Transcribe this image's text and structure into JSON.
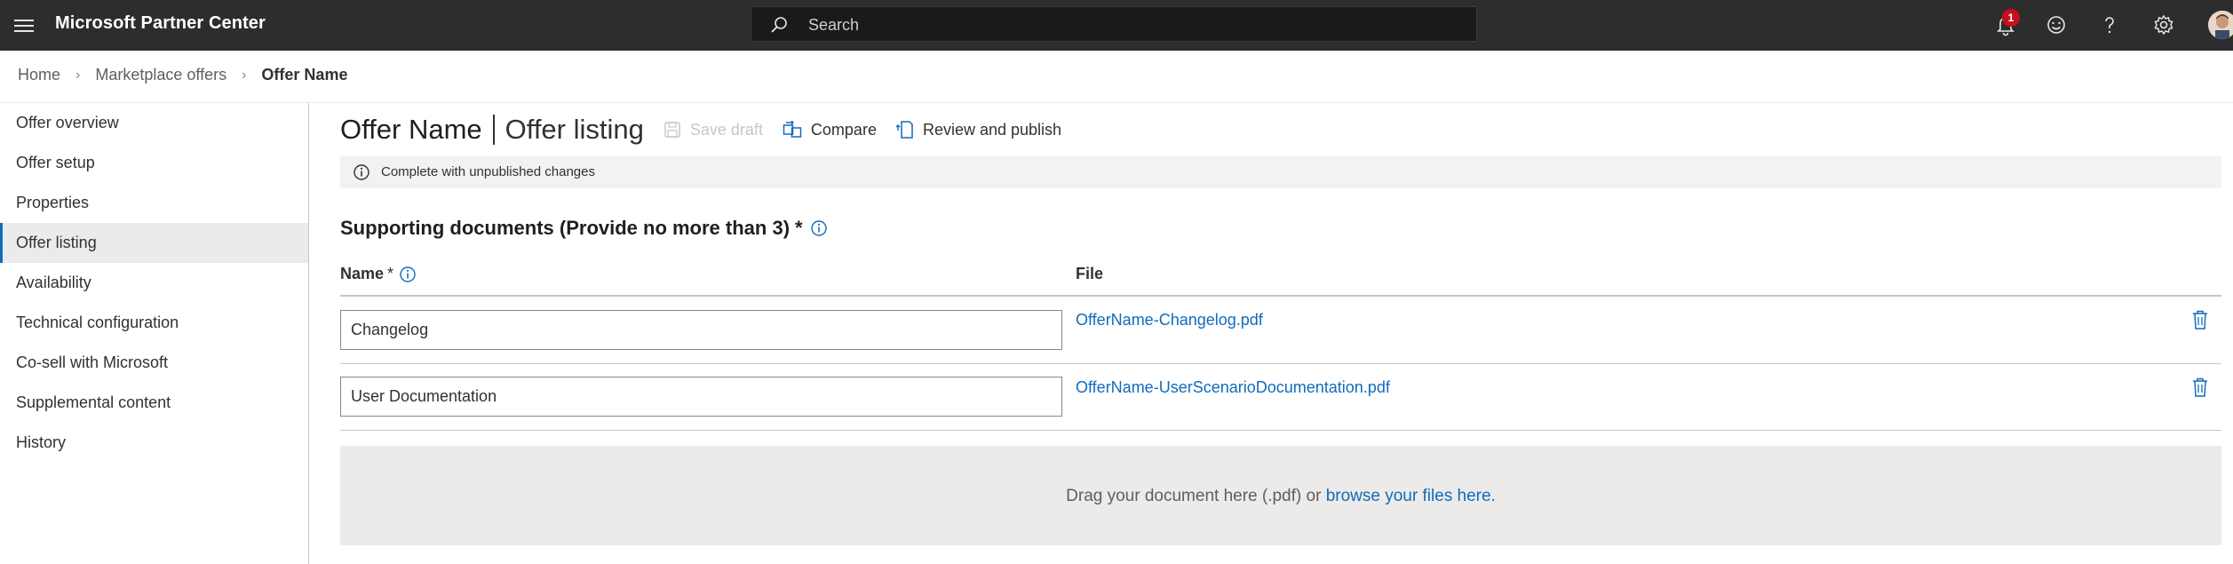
{
  "header": {
    "app_title": "Microsoft Partner Center",
    "search_placeholder": "Search",
    "notification_count": "1",
    "icons": [
      "menu-icon",
      "search-icon",
      "bell-icon",
      "smiley-icon",
      "help-icon",
      "gear-icon",
      "avatar"
    ]
  },
  "breadcrumb": {
    "items": [
      "Home",
      "Marketplace offers"
    ],
    "current": "Offer Name"
  },
  "sidebar": {
    "items": [
      {
        "label": "Offer overview"
      },
      {
        "label": "Offer setup"
      },
      {
        "label": "Properties"
      },
      {
        "label": "Offer listing",
        "active": true
      },
      {
        "label": "Availability"
      },
      {
        "label": "Technical configuration"
      },
      {
        "label": "Co-sell with Microsoft"
      },
      {
        "label": "Supplemental content"
      },
      {
        "label": "History"
      }
    ]
  },
  "main": {
    "offer_name": "Offer Name",
    "page_name": "Offer listing",
    "commands": {
      "save_draft": "Save draft",
      "compare": "Compare",
      "review_publish": "Review and publish"
    },
    "status": "Complete with unpublished changes",
    "section_title": "Supporting documents (Provide no more than 3)",
    "required_marker": "*",
    "columns": {
      "name": "Name",
      "file": "File"
    },
    "documents": [
      {
        "name": "Changelog",
        "file": "OfferName-Changelog.pdf"
      },
      {
        "name": "User Documentation",
        "file": "OfferName-UserScenarioDocumentation.pdf"
      }
    ],
    "dropzone": {
      "text": "Drag your document here (.pdf) or ",
      "link": "browse your files here."
    }
  },
  "colors": {
    "topbar": "#2d2d2d",
    "accent": "#0f6cbd",
    "badge": "#c50f1f"
  }
}
